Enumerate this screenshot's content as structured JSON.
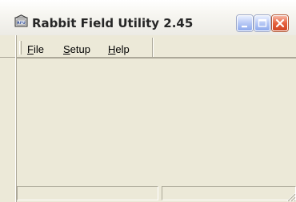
{
  "window": {
    "title": "Rabbit Field Utility 2.45",
    "icon": "rfu-app-icon",
    "controls": {
      "minimize_icon": "minimize-icon",
      "maximize_icon": "maximize-icon",
      "close_icon": "close-icon"
    }
  },
  "menubar": {
    "items": [
      {
        "label": "File",
        "mnemonic": "F"
      },
      {
        "label": "Setup",
        "mnemonic": "S"
      },
      {
        "label": "Help",
        "mnemonic": "H"
      }
    ]
  },
  "statusbar": {
    "panes": [
      "",
      ""
    ]
  },
  "colors": {
    "face": "#ece9d8",
    "shadow": "#aca899",
    "close_button": "#e5623f",
    "control_button": "#b7c8f5"
  }
}
